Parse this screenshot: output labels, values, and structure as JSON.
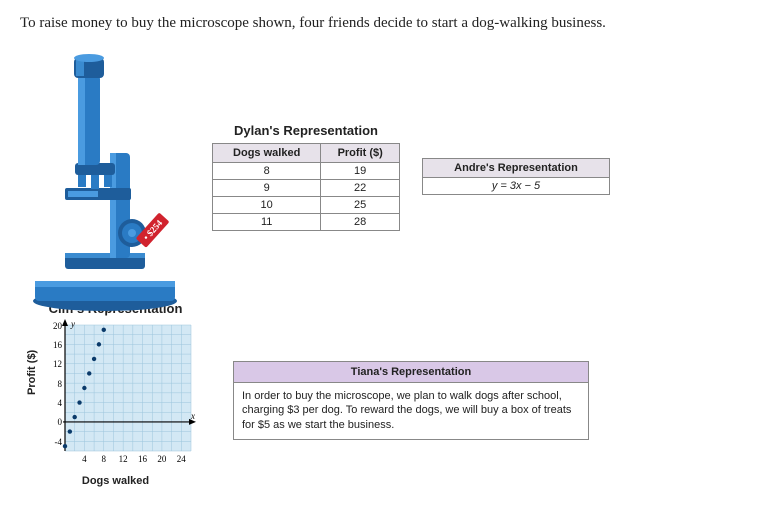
{
  "intro": "To raise money to buy the microscope shown, four friends decide to start a dog-walking business.",
  "microscope": {
    "price_tag": "• $254"
  },
  "dylan": {
    "title": "Dylan's Representation",
    "headers": [
      "Dogs walked",
      "Profit ($)"
    ],
    "rows": [
      {
        "dogs": "8",
        "profit": "19"
      },
      {
        "dogs": "9",
        "profit": "22"
      },
      {
        "dogs": "10",
        "profit": "25"
      },
      {
        "dogs": "11",
        "profit": "28"
      }
    ]
  },
  "andre": {
    "title": "Andre's Representation",
    "equation": "y = 3x − 5"
  },
  "cliff": {
    "title": "Cliff's Representation",
    "xlabel": "Dogs walked",
    "ylabel": "Profit ($)",
    "y_ticks": [
      "-4",
      "0",
      "4",
      "8",
      "12",
      "16",
      "20"
    ],
    "x_ticks": [
      "4",
      "8",
      "12",
      "16",
      "20",
      "24"
    ]
  },
  "tiana": {
    "title": "Tiana's Representation",
    "text": "In order to buy the microscope, we plan to walk dogs after school, charging $3 per dog. To reward the dogs, we will buy a box of treats for $5 as we start the business."
  },
  "chart_data": {
    "type": "scatter",
    "title": "Cliff's Representation",
    "xlabel": "Dogs walked",
    "ylabel": "Profit ($)",
    "xlim": [
      0,
      26
    ],
    "ylim": [
      -6,
      20
    ],
    "x": [
      0,
      1,
      2,
      3,
      4,
      5,
      6,
      7,
      8
    ],
    "y": [
      -5,
      -2,
      1,
      4,
      7,
      10,
      13,
      16,
      19
    ]
  }
}
